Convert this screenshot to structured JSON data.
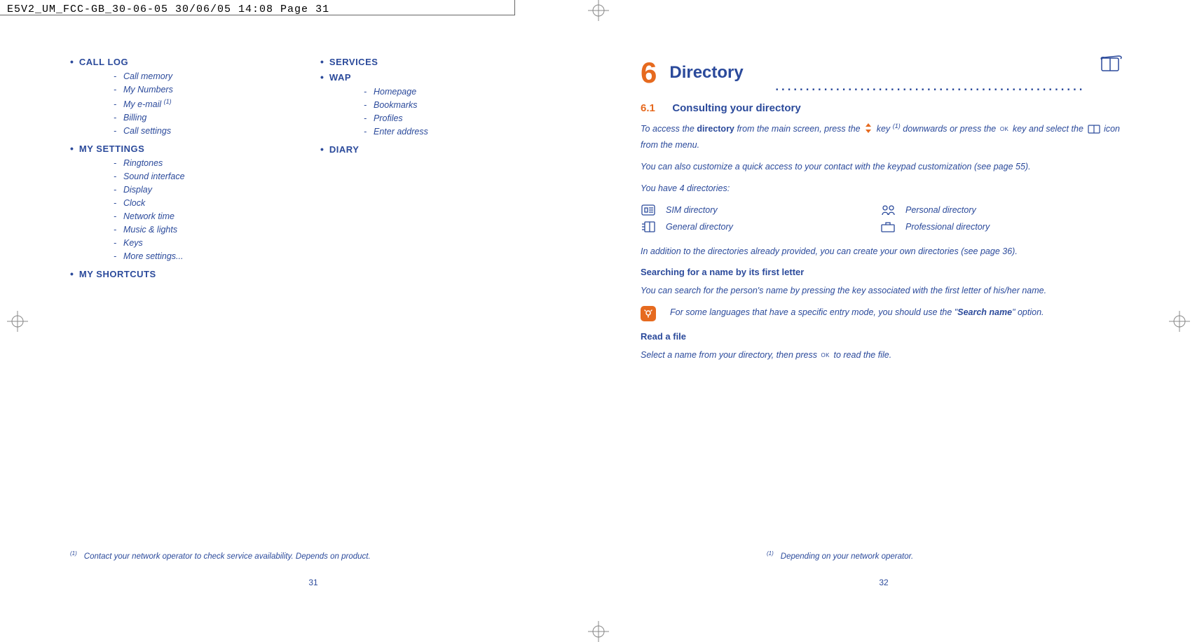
{
  "header_crop": "E5V2_UM_FCC-GB_30-06-05  30/06/05  14:08  Page 31",
  "left": {
    "col1": [
      {
        "head": "CALL LOG",
        "subs": [
          "Call memory",
          "My Numbers",
          "My e-mail (1)",
          "Billing",
          "Call settings"
        ]
      },
      {
        "head": "MY SETTINGS",
        "subs": [
          "Ringtones",
          "Sound interface",
          "Display",
          "Clock",
          "Network time",
          "Music & lights",
          "Keys",
          "More settings..."
        ]
      },
      {
        "head": "MY SHORTCUTS",
        "subs": []
      }
    ],
    "col2": [
      {
        "head": "SERVICES",
        "subs": []
      },
      {
        "head": "WAP",
        "subs": [
          "Homepage",
          "Bookmarks",
          "Profiles",
          "Enter address"
        ]
      },
      {
        "head": "DIARY",
        "subs": []
      }
    ],
    "footnote_mark": "(1)",
    "footnote": "Contact your network operator to check service availability. Depends on product.",
    "pagenum": "31"
  },
  "right": {
    "chapter_num": "6",
    "chapter_title": "Directory",
    "section_num": "6.1",
    "section_title": "Consulting your directory",
    "p1_a": "To access the ",
    "p1_b": "directory",
    "p1_c": " from the main screen, press the ",
    "p1_d": " key ",
    "p1_sup": "(1)",
    "p1_e": " downwards or press the ",
    "p1_f": " key and select the ",
    "p1_g": " icon from the menu.",
    "p2": "You can also customize a quick access to your contact with the keypad customization (see page 55).",
    "p3": "You have 4 directories:",
    "dirs": [
      {
        "icon": "sim-icon",
        "text": "SIM directory"
      },
      {
        "icon": "general-icon",
        "text": "General directory"
      },
      {
        "icon": "personal-icon",
        "text": "Personal directory"
      },
      {
        "icon": "professional-icon",
        "text": "Professional directory"
      }
    ],
    "p4": "In addition to the directories already provided, you can create your own directories (see page 36).",
    "sub1": "Searching for a name by its first letter",
    "p5": "You can search for the person's name by pressing the key associated with the first letter of his/her name.",
    "tip_a": "For some languages that have a specific entry mode, you should use the \"",
    "tip_b": "Search name",
    "tip_c": "\" option.",
    "sub2": "Read a file",
    "p6_a": "Select a name from your directory, then press ",
    "p6_b": " to read the file.",
    "footnote_mark": "(1)",
    "footnote": "Depending on your network operator.",
    "pagenum": "32"
  },
  "ok_label": "OK"
}
